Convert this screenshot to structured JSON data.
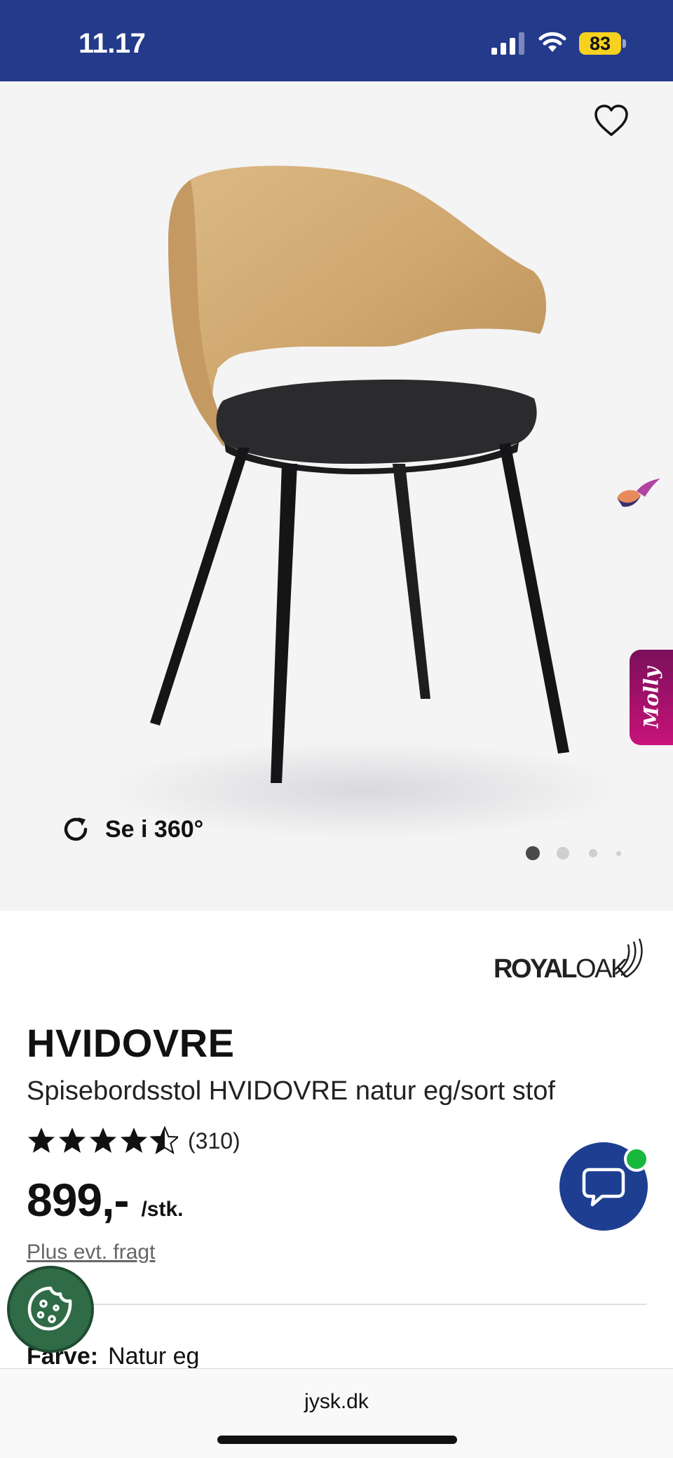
{
  "status_bar": {
    "time": "11.17",
    "battery_level": "83",
    "signal_icon": "cellular-signal-icon",
    "wifi_icon": "wifi-icon",
    "background": "#243a8a"
  },
  "gallery": {
    "favorite_icon": "heart-outline-icon",
    "view_360_icon": "rotate-icon",
    "view_360_label": "Se i 360°",
    "image_count": 4,
    "active_image": 1,
    "molly_label": "Molly"
  },
  "product": {
    "brand": {
      "part1": "ROYAL",
      "part2": "OAK"
    },
    "title": "HVIDOVRE",
    "subtitle": "Spisebordsstol HVIDOVRE natur eg/sort stof",
    "rating": {
      "value": 4.5,
      "max": 5,
      "count_label": "(310)"
    },
    "price": "899,-",
    "price_unit": "/stk.",
    "shipping_note": "Plus evt. fragt",
    "color_label": "Farve:",
    "color_value": "Natur eg"
  },
  "floating": {
    "chat_icon": "chat-bubble-icon",
    "chat_online_color": "#17b83c",
    "cookie_icon": "cookie-icon"
  },
  "browser": {
    "url": "jysk.dk"
  },
  "colors": {
    "brand_blue": "#1e3f91",
    "molly_magenta": "#c8137a",
    "cookie_green": "#2f6b46"
  }
}
